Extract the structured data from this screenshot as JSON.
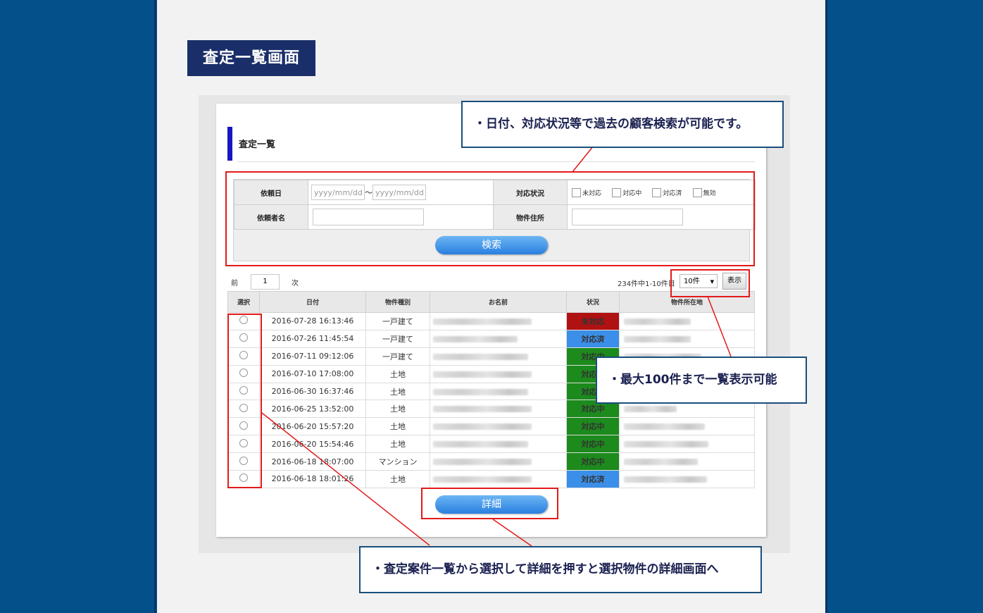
{
  "title_label": "査定一覧画面",
  "page_heading": "査定一覧",
  "search": {
    "request_date_label": "依頼日",
    "date_from_placeholder": "yyyy/mm/dd",
    "date_tilde": "～",
    "date_to_placeholder": "yyyy/mm/dd",
    "status_label": "対応状況",
    "status_options": [
      "未対応",
      "対応中",
      "対応済",
      "無効"
    ],
    "requester_label": "依頼者名",
    "address_label": "物件住所",
    "search_button": "検索"
  },
  "pager": {
    "prev_label": "前",
    "page_value": "1",
    "next_label": "次",
    "count_text": "234件中1-10件目",
    "per_page_value": "10件",
    "show_button": "表示"
  },
  "table": {
    "headers": [
      "選択",
      "日付",
      "物件種別",
      "お名前",
      "状況",
      "物件所在地"
    ],
    "rows": [
      {
        "date": "2016-07-28 16:13:46",
        "type": "一戸建て",
        "status": "未対応"
      },
      {
        "date": "2016-07-26 11:45:54",
        "type": "一戸建て",
        "status": "対応済"
      },
      {
        "date": "2016-07-11 09:12:06",
        "type": "一戸建て",
        "status": "対応中"
      },
      {
        "date": "2016-07-10 17:08:00",
        "type": "土地",
        "status": "対応中"
      },
      {
        "date": "2016-06-30 16:37:46",
        "type": "土地",
        "status": "対応中"
      },
      {
        "date": "2016-06-25 13:52:00",
        "type": "土地",
        "status": "対応中"
      },
      {
        "date": "2016-06-20 15:57:20",
        "type": "土地",
        "status": "対応中"
      },
      {
        "date": "2016-06-20 15:54:46",
        "type": "土地",
        "status": "対応中"
      },
      {
        "date": "2016-06-18 18:07:00",
        "type": "マンション",
        "status": "対応中"
      },
      {
        "date": "2016-06-18 18:01:26",
        "type": "土地",
        "status": "対応済"
      }
    ]
  },
  "detail_button": "詳細",
  "status_colors": {
    "未対応": "#b01212",
    "対応中": "#1c8a1c",
    "対応済": "#3b8fe8"
  },
  "callouts": {
    "search": "・日付、対応状況等で過去の顧客検索が可能です。",
    "display": "・最大100件まで一覧表示可能",
    "detail": "・査定案件一覧から選択して詳細を押すと選択物件の詳細画面へ"
  }
}
